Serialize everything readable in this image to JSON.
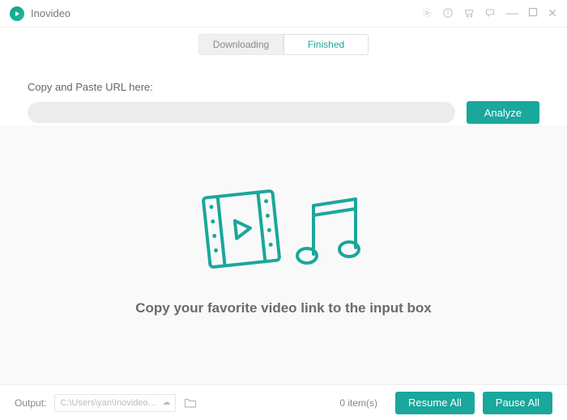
{
  "app": {
    "name": "Inovideo"
  },
  "tabs": {
    "downloading": "Downloading",
    "finished": "Finished",
    "active": "finished"
  },
  "url_panel": {
    "label": "Copy and Paste URL here:",
    "placeholder": "",
    "analyze_btn": "Analyze"
  },
  "main": {
    "hint": "Copy your favorite video link to the input box"
  },
  "footer": {
    "output_label": "Output:",
    "output_path": "C:\\Users\\yan\\Inovideo\\D...",
    "item_count": "0 item(s)",
    "resume_btn": "Resume All",
    "pause_btn": "Pause All"
  },
  "colors": {
    "accent": "#1aa79c"
  }
}
